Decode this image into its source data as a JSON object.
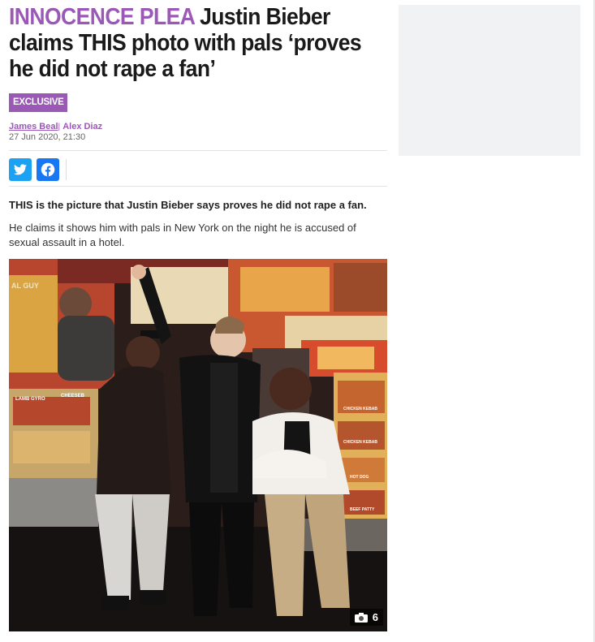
{
  "headline": {
    "kicker": "INNOCENCE PLEA",
    "title": "Justin Bieber claims THIS photo with pals ‘proves he did not rape a fan’"
  },
  "badge": "EXCLUSIVE",
  "byline": {
    "author1": "James Beal",
    "separator": "|",
    "author2": "Alex Diaz",
    "date": "27 Jun 2020, 21:30"
  },
  "share": {
    "twitter": "twitter-icon",
    "facebook": "facebook-icon"
  },
  "body": {
    "lead": "THIS is the picture that Justin Bieber says proves he did not rape a fan.",
    "para1": "He claims it shows him with pals in New York on the night he is accused of sexual assault in a hotel."
  },
  "photo": {
    "count": "6",
    "count_icon": "camera-icon",
    "signs": [
      "AL GUY",
      "LAMB GYRO",
      "CHEESEB",
      "CHICKEN KEBAB",
      "CHICKEN KEBAB",
      "HOT DOG",
      "BEEF PATTY"
    ]
  },
  "colors": {
    "accent": "#9b59b6",
    "twitter": "#1da1f2",
    "facebook": "#1877f2"
  }
}
